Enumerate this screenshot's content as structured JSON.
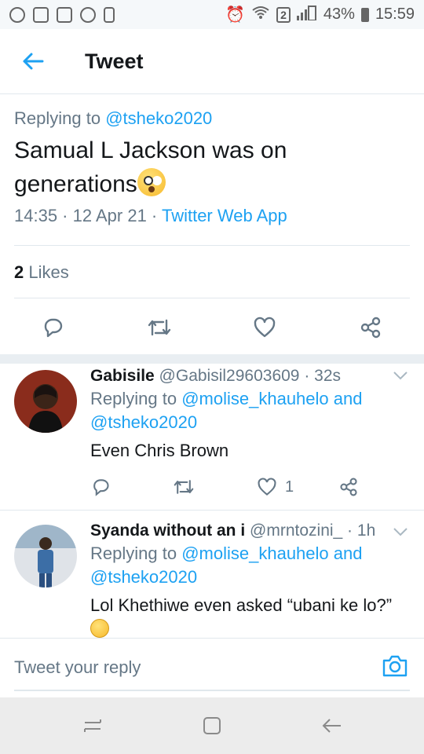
{
  "status_bar": {
    "signal_badge": "2",
    "battery": "43%",
    "time": "15:59"
  },
  "header": {
    "title": "Tweet",
    "back_icon": "arrow-left-icon"
  },
  "tweet": {
    "replying_prefix": "Replying to",
    "replying_handle": "@tsheko2020",
    "text": "Samual L Jackson was on generations",
    "emoji": "astonished-face-emoji",
    "time": "14:35",
    "date": "12 Apr 21",
    "source": "Twitter Web App",
    "likes_count": "2",
    "likes_label": "Likes"
  },
  "replies": [
    {
      "name": "Gabisile",
      "handle": "@Gabisil29603609",
      "age": "32s",
      "replying_prefix": "Replying to",
      "replying_handle_1": "@molise_khauhelo",
      "replying_and": "and",
      "replying_handle_2": "@tsheko2020",
      "text": "Even Chris Brown",
      "like_count": "1"
    },
    {
      "name": "Syanda without an i",
      "handle": "@mrntozini_",
      "age": "1h",
      "replying_prefix": "Replying to",
      "replying_handle_1": "@molise_khauhelo",
      "replying_and": "and",
      "replying_handle_2": "@tsheko2020",
      "text": "Lol Khethiwe even asked “ubani ke lo?”"
    }
  ],
  "compose": {
    "placeholder": "Tweet your reply",
    "camera_icon": "camera-icon"
  },
  "colors": {
    "accent": "#1da1f2",
    "secondary_text": "#657786",
    "primary_text": "#14171a"
  }
}
